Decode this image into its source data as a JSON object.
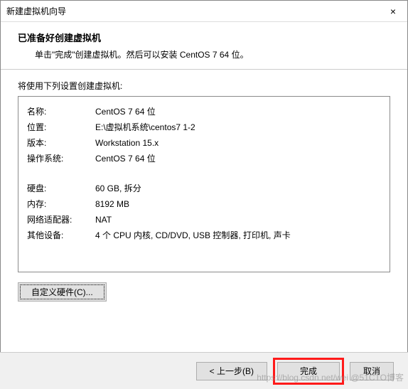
{
  "window": {
    "title": "新建虚拟机向导",
    "close_icon": "×"
  },
  "header": {
    "heading": "已准备好创建虚拟机",
    "subheading": "单击\"完成\"创建虚拟机。然后可以安装 CentOS 7 64 位。"
  },
  "content": {
    "list_label": "将使用下列设置创建虚拟机:",
    "rows": [
      {
        "key": "名称:",
        "val": "CentOS 7 64 位"
      },
      {
        "key": "位置:",
        "val": "E:\\虚拟机系统\\centos7 1-2"
      },
      {
        "key": "版本:",
        "val": "Workstation 15.x"
      },
      {
        "key": "操作系统:",
        "val": "CentOS 7 64 位"
      }
    ],
    "rows2": [
      {
        "key": "硬盘:",
        "val": "60 GB, 拆分"
      },
      {
        "key": "内存:",
        "val": "8192 MB"
      },
      {
        "key": "网络适配器:",
        "val": "NAT"
      },
      {
        "key": "其他设备:",
        "val": "4 个 CPU 内核, CD/DVD, USB 控制器, 打印机, 声卡"
      }
    ],
    "customize_label": "自定义硬件(C)..."
  },
  "footer": {
    "back": "< 上一步(B)",
    "finish": "完成",
    "cancel": "取消"
  },
  "watermark": "https://blog.csdn.net/wei @51CTO博客"
}
